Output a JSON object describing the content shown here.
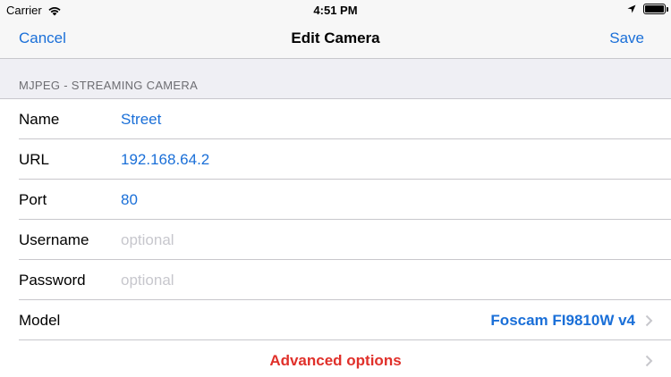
{
  "status_bar": {
    "carrier": "Carrier",
    "time": "4:51 PM"
  },
  "nav": {
    "cancel_label": "Cancel",
    "title": "Edit Camera",
    "save_label": "Save"
  },
  "section": {
    "header": "MJPEG - STREAMING CAMERA"
  },
  "fields": [
    {
      "label": "Name",
      "value": "Street",
      "placeholder": ""
    },
    {
      "label": "URL",
      "value": "192.168.64.2",
      "placeholder": ""
    },
    {
      "label": "Port",
      "value": "80",
      "placeholder": ""
    },
    {
      "label": "Username",
      "value": "",
      "placeholder": "optional"
    },
    {
      "label": "Password",
      "value": "",
      "placeholder": "optional"
    }
  ],
  "model": {
    "label": "Model",
    "value": "Foscam FI9810W v4"
  },
  "advanced": {
    "label": "Advanced options"
  },
  "colors": {
    "accent": "#1a6fd8",
    "destructive": "#e0302a",
    "placeholder": "#c7c7cd",
    "separator": "#c8c7cc",
    "background": "#efeff4"
  }
}
